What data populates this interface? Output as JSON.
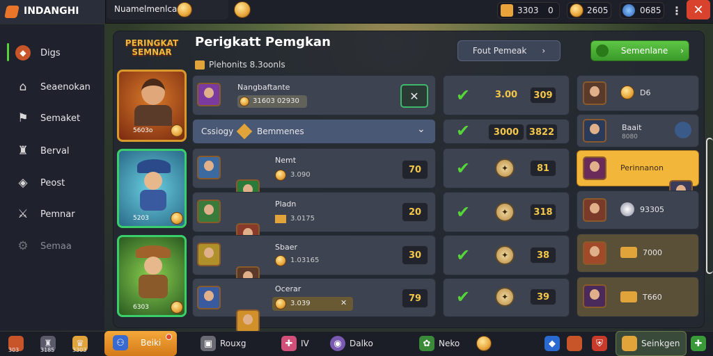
{
  "app_title": "INDANGHI",
  "header": {
    "name": "Nuamelmenlcas",
    "res1": "3303",
    "res1b": "0",
    "res2": "2605",
    "res3": "0685"
  },
  "sidebar": {
    "items": [
      {
        "label": "Digs",
        "icon": "shield-icon"
      },
      {
        "label": "Seaenokan",
        "icon": "house-icon"
      },
      {
        "label": "Semaket",
        "icon": "flag-icon"
      },
      {
        "label": "Berval",
        "icon": "castle-icon"
      },
      {
        "label": "Peost",
        "icon": "tag-icon"
      },
      {
        "label": "Pemnar",
        "icon": "sword-icon"
      },
      {
        "label": "Semaa",
        "icon": "gear-icon"
      }
    ]
  },
  "panel": {
    "title": "Perigkatt Pemgkan",
    "subtitle": "Plehonits 8.3oonls",
    "logo_text": "PERINGKAT SEMNAR",
    "btn_fout": "Fout Pemeak",
    "btn_semen": "Semenlane"
  },
  "hero_card": {
    "value": "5603o"
  },
  "rows": [
    {
      "name": "Nangbaftante",
      "value": "31603 02930",
      "right1": "3.00",
      "right2": "309"
    },
    {
      "name": "Cssiogy",
      "sub": "Bemmenes",
      "right1": "3000",
      "right2": "3822"
    },
    {
      "name": "Nemt",
      "value": "3.090",
      "score": "70",
      "right2": "81"
    },
    {
      "name": "Pladn",
      "value": "3.0175",
      "score": "20",
      "right2": "318"
    },
    {
      "name": "Sbaer",
      "value": "1.03165",
      "score": "30",
      "right2": "38"
    },
    {
      "name": "Ocerar",
      "value": "3.039",
      "score": "79",
      "right2": "39"
    }
  ],
  "right_list": [
    {
      "label": "D6"
    },
    {
      "label": "Baait",
      "sub": "8080"
    },
    {
      "label": "Perinnanon"
    },
    {
      "label": "93305"
    },
    {
      "label": "7000"
    },
    {
      "label": "T660"
    }
  ],
  "card2": {
    "value": "5203"
  },
  "card3": {
    "value": "6303"
  },
  "bottombar": {
    "items": [
      {
        "label": "303"
      },
      {
        "label": "3185"
      },
      {
        "label": "3303"
      },
      {
        "label": "Beiki"
      },
      {
        "label": "Rouxg"
      },
      {
        "label": "IV"
      },
      {
        "label": "Dalko"
      },
      {
        "label": "Neko"
      },
      {
        "label": "Seinkgen"
      }
    ]
  },
  "colors": {
    "accent": "#f1b73a",
    "green": "#56d43a",
    "panel": "#2c303b"
  }
}
